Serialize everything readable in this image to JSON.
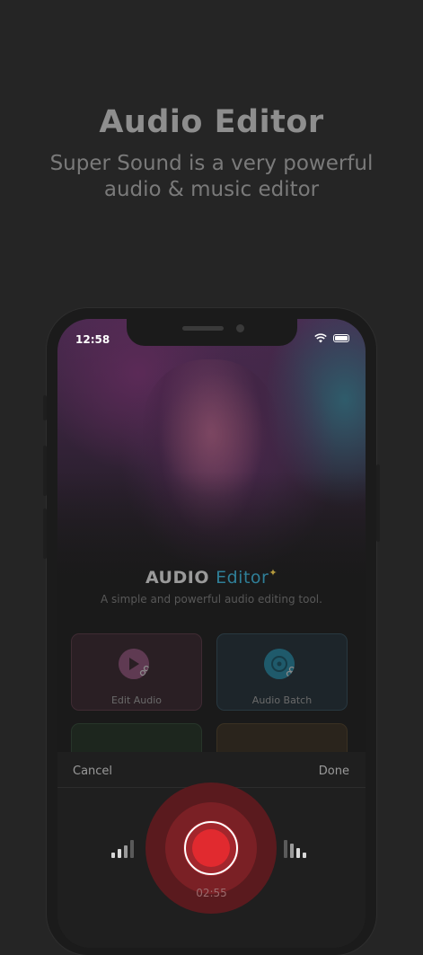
{
  "promo": {
    "title": "Audio Editor",
    "subtitle": "Super Sound is a very powerful audio & music editor"
  },
  "status_bar": {
    "time": "12:58",
    "icons": [
      "wifi-icon",
      "battery-icon"
    ]
  },
  "app": {
    "title_main": "AUDIO",
    "title_accent": "Editor",
    "title_decoration": "✦",
    "tagline": "A simple and powerful audio editing tool.",
    "colors": {
      "accent": "#2f7f98",
      "record": "#e12a2f"
    }
  },
  "tools": [
    {
      "label": "Edit Audio",
      "icon": "play-scissors-icon"
    },
    {
      "label": "Audio Batch",
      "icon": "disc-scissors-icon"
    }
  ],
  "recorder": {
    "cancel_label": "Cancel",
    "done_label": "Done",
    "elapsed": "02:55"
  }
}
